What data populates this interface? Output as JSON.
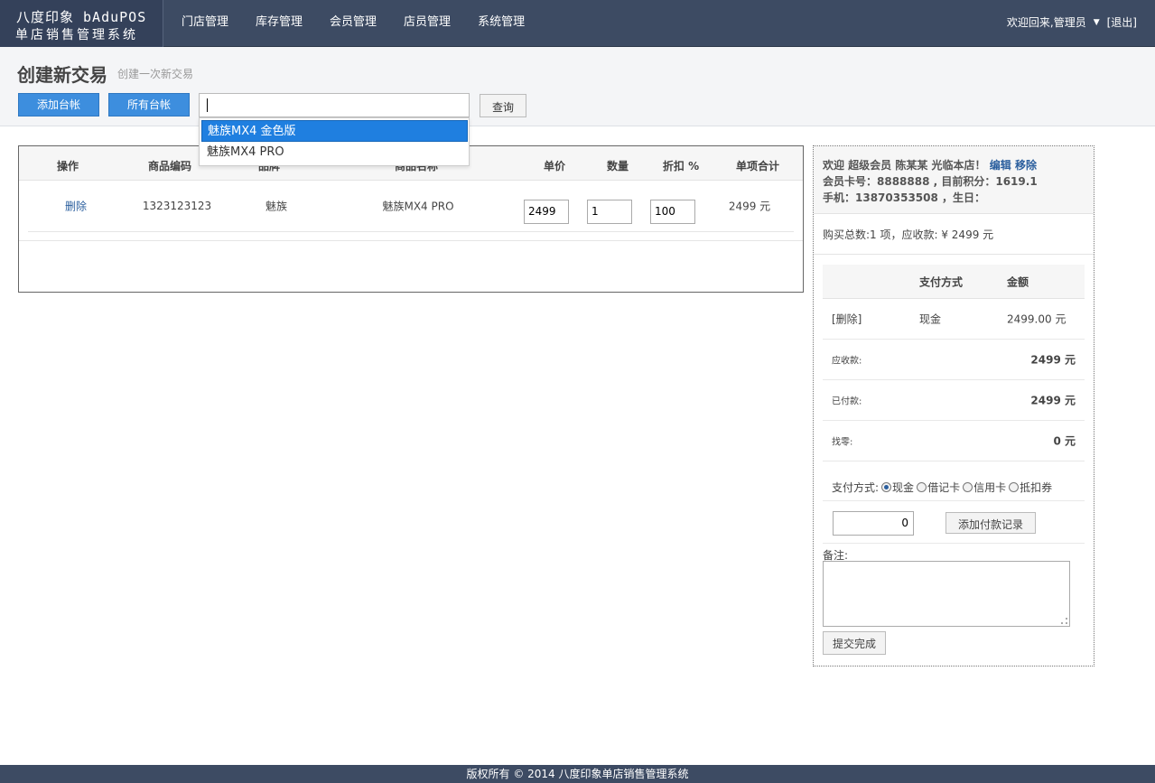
{
  "brand": {
    "line1": "八度印象 bAduPOS",
    "line2": "单店销售管理系统"
  },
  "nav": [
    "门店管理",
    "库存管理",
    "会员管理",
    "店员管理",
    "系统管理"
  ],
  "user": {
    "welcome": "欢迎回来,管理员",
    "logout": "[退出]"
  },
  "page": {
    "title": "创建新交易",
    "subtitle": "创建一次新交易"
  },
  "toolbar": {
    "add_ledger": "添加台帐",
    "all_ledgers": "所有台帐",
    "search_value": "",
    "query": "查询"
  },
  "dropdown": [
    "魅族MX4 金色版",
    "魅族MX4 PRO"
  ],
  "table": {
    "headers": [
      "操作",
      "商品编码",
      "品牌",
      "商品名称",
      "单价",
      "数量",
      "折扣 %",
      "单项合计"
    ],
    "rows": [
      {
        "action": "删除",
        "code": "1323123123",
        "brand": "魅族",
        "name": "魅族MX4 PRO",
        "price": "2499",
        "qty": "1",
        "discount": "100",
        "subtotal": "2499 元"
      }
    ]
  },
  "member": {
    "greet_prefix": "欢迎 超级会员 陈某某 光临本店！",
    "edit": "编辑",
    "remove": "移除",
    "card_line": "会员卡号：8888888 , 目前积分：1619.1",
    "phone_line": "手机：13870353508 ，生日："
  },
  "summary": "购买总数:1 项，应收款: ¥  2499 元",
  "payments": {
    "headers": [
      "支付方式",
      "金额"
    ],
    "rows": [
      {
        "action": "[删除]",
        "method": "现金",
        "amount": "2499.00 元"
      }
    ]
  },
  "totals": {
    "due_label": "应收款:",
    "due": "2499 元",
    "paid_label": "已付款:",
    "paid": "2499 元",
    "change_label": "找零:",
    "change": "0 元"
  },
  "payway": {
    "label": "支付方式:",
    "options": [
      "现金",
      "借记卡",
      "信用卡",
      "抵扣券"
    ],
    "selected": "现金"
  },
  "pay_amount": "0",
  "add_payment": "添加付款记录",
  "remark_label": "备注:",
  "submit": "提交完成",
  "footer": "版权所有 © 2014 八度印象单店销售管理系统"
}
